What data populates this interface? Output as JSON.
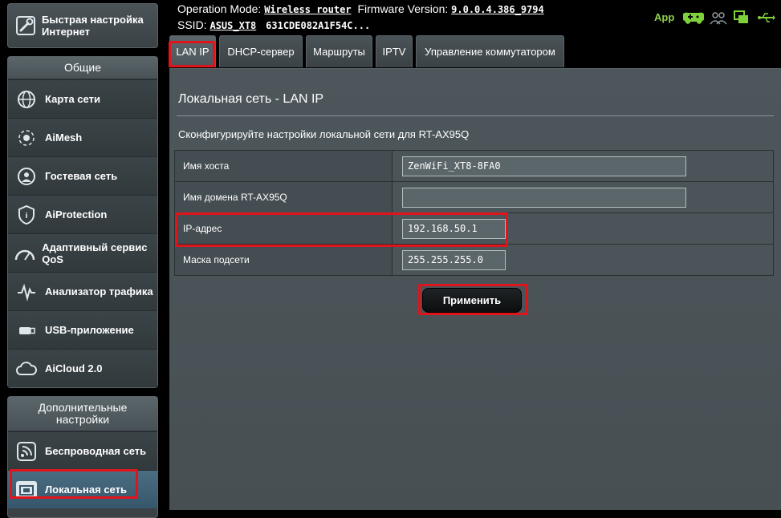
{
  "status": {
    "operation_mode_label": "Operation Mode:",
    "operation_mode_value": "Wireless router",
    "firmware_label": "Firmware Version:",
    "firmware_value": "9.0.0.4.386_9794",
    "ssid_label": "SSID:",
    "ssid_value": "ASUS_XT8",
    "ssid_extra": "631CDE082A1F54C...",
    "app_label": "App"
  },
  "sidebar": {
    "quick_setup": "Быстрая настройка Интернет",
    "general_header": "Общие",
    "general_items": [
      {
        "label": "Карта сети",
        "icon": "globe-icon"
      },
      {
        "label": "AiMesh",
        "icon": "mesh-icon"
      },
      {
        "label": "Гостевая сеть",
        "icon": "guest-network-icon"
      },
      {
        "label": "AiProtection",
        "icon": "shield-icon"
      },
      {
        "label": "Адаптивный сервис QoS",
        "icon": "gauge-icon"
      },
      {
        "label": "Анализатор трафика",
        "icon": "traffic-icon"
      },
      {
        "label": "USB-приложение",
        "icon": "usb-icon"
      },
      {
        "label": "AiCloud 2.0",
        "icon": "cloud-icon"
      }
    ],
    "advanced_header": "Дополнительные настройки",
    "advanced_items": [
      {
        "label": "Беспроводная сеть",
        "icon": "wifi-icon"
      },
      {
        "label": "Локальная сеть",
        "icon": "lan-icon"
      }
    ]
  },
  "tabs": [
    "LAN IP",
    "DHCP-сервер",
    "Маршруты",
    "IPTV",
    "Управление коммутатором"
  ],
  "main": {
    "title": "Локальная сеть - LAN IP",
    "description": "Сконфигурируйте настройки локальной сети для RT-AX95Q",
    "fields": [
      {
        "label": "Имя хоста",
        "value": ""
      },
      {
        "label": "Имя домена RT-AX95Q",
        "value": ""
      },
      {
        "label": "IP-адрес",
        "value": ""
      },
      {
        "label": "Маска подсети",
        "value": ""
      }
    ],
    "field_values": [
      "ZenWiFi_XT8-8FA0",
      "",
      "192.168.50.1",
      "255.255.255.0"
    ],
    "apply_label": "Применить"
  },
  "colors": {
    "highlight": "#e0141b",
    "app_green": "#8fd24a",
    "panel": "#4a5357"
  }
}
